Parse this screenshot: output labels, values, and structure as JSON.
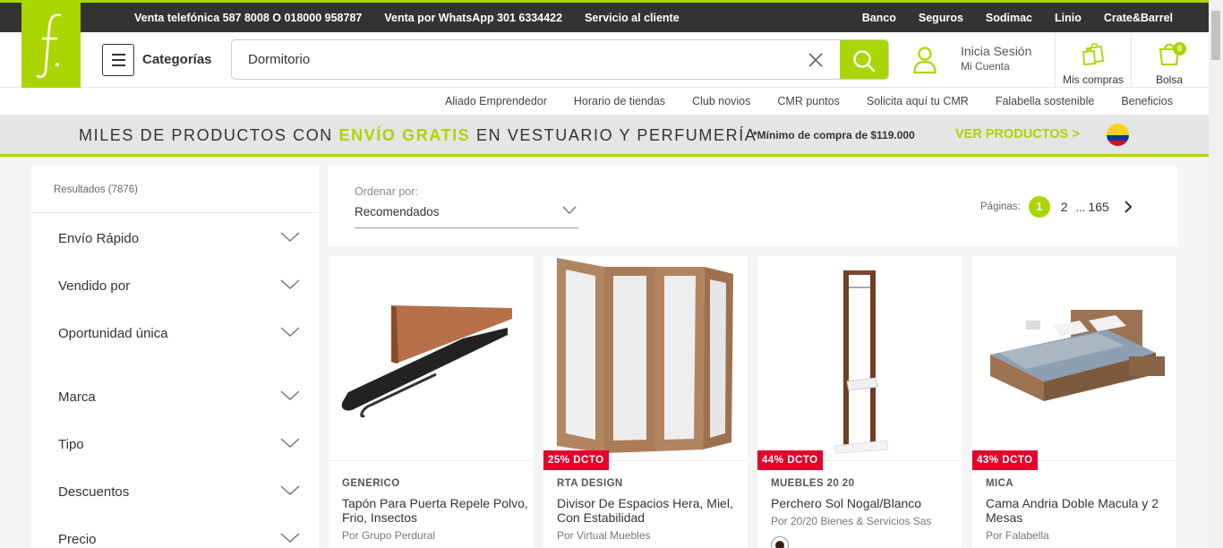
{
  "topbar": {
    "left_links": [
      "Venta telefónica 587 8008 O 018000 958787",
      "Venta por WhatsApp 301 6334422",
      "Servicio al cliente"
    ],
    "right_links": [
      "Banco",
      "Seguros",
      "Sodimac",
      "Linio",
      "Crate&Barrel"
    ]
  },
  "header": {
    "categories_label": "Categorías",
    "search_value": "Dormitorio",
    "login_line1": "Inicia Sesión",
    "login_line2": "Mi Cuenta",
    "purchases_label": "Mis compras",
    "bag_label": "Bolsa",
    "bag_count": "0"
  },
  "subnav": [
    "Aliado Emprendedor",
    "Horario de tiendas",
    "Club novios",
    "CMR puntos",
    "Solicita aquí tu CMR",
    "Falabella sostenible",
    "Beneficios"
  ],
  "promo": {
    "text_before": "MILES DE PRODUCTOS CON ",
    "highlight": "ENVÍO GRATIS",
    "text_after": " EN VESTUARIO Y PERFUMERÍA",
    "minimum": "*Mínimo de compra de $119.000",
    "cta": "VER PRODUCTOS >"
  },
  "sidebar": {
    "results": "Resultados (7876)",
    "filters": [
      "Envío Rápido",
      "Vendido por",
      "Oportunidad única",
      "Marca",
      "Tipo",
      "Descuentos",
      "Precio"
    ]
  },
  "sort": {
    "label": "Ordenar por:",
    "value": "Recomendados"
  },
  "pagination": {
    "label": "Páginas:",
    "current": "1",
    "next_page": "2",
    "ellipsis": "...",
    "last": "165"
  },
  "products": [
    {
      "brand": "GENERICO",
      "title": "Tapón Para Puerta Repele Polvo, Frio, Insectos",
      "seller": "Por Grupo Perdural",
      "badge": ""
    },
    {
      "brand": "RTA DESIGN",
      "title": "Divisor De Espacios Hera, Miel, Con Estabilidad",
      "seller": "Por Virtual Muebles",
      "badge": "25% DCTO"
    },
    {
      "brand": "MUEBLES 20 20",
      "title": "Perchero Sol Nogal/Blanco",
      "seller": "Por 20/20 Bienes & Servicios Sas",
      "badge": "44% DCTO"
    },
    {
      "brand": "MICA",
      "title": "Cama Andria Doble Macula y 2 Mesas",
      "seller": "Por Falabella",
      "badge": "43% DCTO"
    }
  ]
}
